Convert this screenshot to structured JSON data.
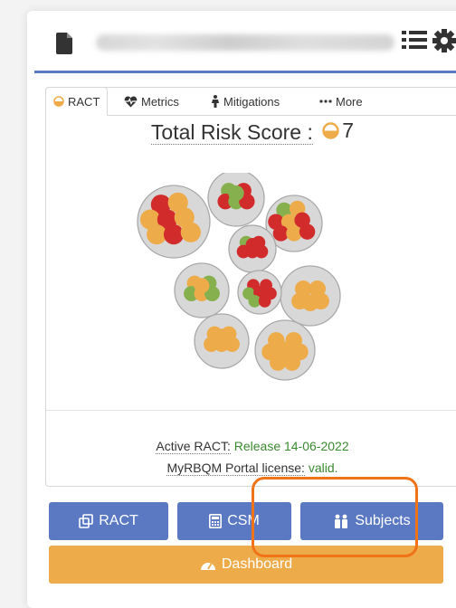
{
  "header": {
    "icons": {
      "document": "file-icon",
      "list": "list-icon",
      "settings": "gear-icon"
    }
  },
  "tabs": [
    {
      "label": "RACT",
      "icon": "half-circle-icon",
      "active": true
    },
    {
      "label": "Metrics",
      "icon": "heartbeat-icon",
      "active": false
    },
    {
      "label": "Mitigations",
      "icon": "female-figure-icon",
      "active": false
    },
    {
      "label": "More",
      "icon": "ellipsis-icon",
      "active": false
    }
  ],
  "score": {
    "label": "Total Risk Score :",
    "value": "7",
    "icon_color": "#edab4a"
  },
  "colors": {
    "red": "#d12b2b",
    "orange": "#edab4a",
    "green": "#86b04e",
    "blue": "#5b79c3",
    "highlight": "#f07317"
  },
  "clusters": [
    [
      "red",
      "orange",
      "orange",
      "red",
      "orange",
      "orange",
      "red",
      "orange"
    ],
    [
      "green",
      "red",
      "red",
      "green",
      "red",
      "green"
    ],
    [
      "green",
      "orange",
      "red",
      "orange",
      "red",
      "red",
      "orange",
      "red"
    ],
    [
      "orange",
      "orange",
      "orange",
      "orange",
      "orange"
    ],
    [
      "orange",
      "green",
      "green",
      "orange",
      "green",
      "orange"
    ],
    [
      "green",
      "red",
      "red",
      "red",
      "red",
      "red"
    ],
    [
      "red",
      "red",
      "green",
      "red",
      "red",
      "green",
      "red"
    ],
    [
      "orange",
      "orange",
      "orange",
      "orange",
      "orange",
      "orange"
    ],
    [
      "orange",
      "orange",
      "orange",
      "orange",
      "orange",
      "orange",
      "orange"
    ]
  ],
  "info": {
    "active_ract_label": "Active RACT:",
    "active_ract_value": "Release 14-06-2022",
    "license_label": "MyRBQM Portal license:",
    "license_value": "valid."
  },
  "buttons": {
    "ract": "RACT",
    "csm": "CSM",
    "subjects": "Subjects",
    "dashboard": "Dashboard"
  }
}
